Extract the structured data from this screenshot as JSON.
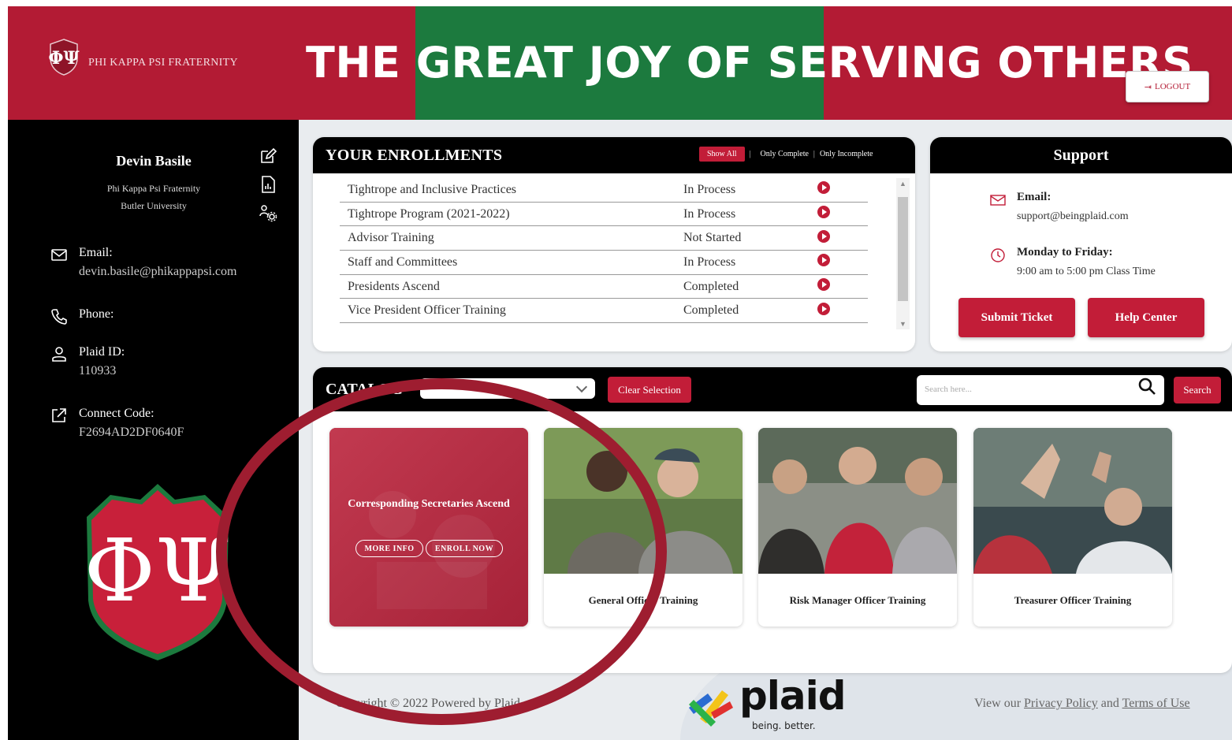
{
  "header": {
    "org_name": "PHI KAPPA PSI FRATERNITY",
    "title": "THE GREAT JOY OF SERVING OTHERS",
    "logout_label": "LOGOUT",
    "colors": {
      "red": "#b31b34",
      "green": "#1c7a3e"
    }
  },
  "profile": {
    "name": "Devin Basile",
    "org": "Phi Kappa Psi Fraternity",
    "school": "Butler University",
    "email_label": "Email:",
    "email": "devin.basile@phikappapsi.com",
    "phone_label": "Phone:",
    "plaid_id_label": "Plaid ID:",
    "plaid_id": "110933",
    "connect_code_label": "Connect Code:",
    "connect_code": "F2694AD2DF0640F"
  },
  "enrollments": {
    "title": "YOUR ENROLLMENTS",
    "filters": {
      "show_all": "Show All",
      "only_complete": "Only Complete",
      "only_incomplete": "Only Incomplete",
      "sep": "|"
    },
    "rows": [
      {
        "name": "Tightrope and Inclusive Practices",
        "status": "In Process"
      },
      {
        "name": "Tightrope Program (2021-2022)",
        "status": "In Process"
      },
      {
        "name": "Advisor Training",
        "status": "Not Started"
      },
      {
        "name": "Staff and Committees",
        "status": "In Process"
      },
      {
        "name": "Presidents Ascend",
        "status": "Completed"
      },
      {
        "name": "Vice President Officer Training",
        "status": "Completed"
      }
    ]
  },
  "support": {
    "title": "Support",
    "email_label": "Email:",
    "email": "support@beingplaid.com",
    "hours_label": "Monday to Friday:",
    "hours": "9:00 am to 5:00 pm Class Time",
    "submit_ticket": "Submit Ticket",
    "help_center": "Help Center"
  },
  "catalog": {
    "title": "CATALOG",
    "clear_selection": "Clear Selection",
    "search_placeholder": "Search here...",
    "search_button": "Search",
    "featured": {
      "title": "Corresponding Secretaries Ascend",
      "more_info": "MORE INFO",
      "enroll_now": "ENROLL NOW"
    },
    "courses": [
      {
        "name": "General Officer Training"
      },
      {
        "name": "Risk Manager Officer Training"
      },
      {
        "name": "Treasurer Officer Training"
      }
    ]
  },
  "footer": {
    "copyright": "Copyright © 2022 Powered by Plaid",
    "plaid_word": "plaid",
    "plaid_tag": "being. better.",
    "links_prefix": "View our",
    "privacy": "Privacy Policy",
    "and": "and",
    "terms": "Terms of Use"
  }
}
